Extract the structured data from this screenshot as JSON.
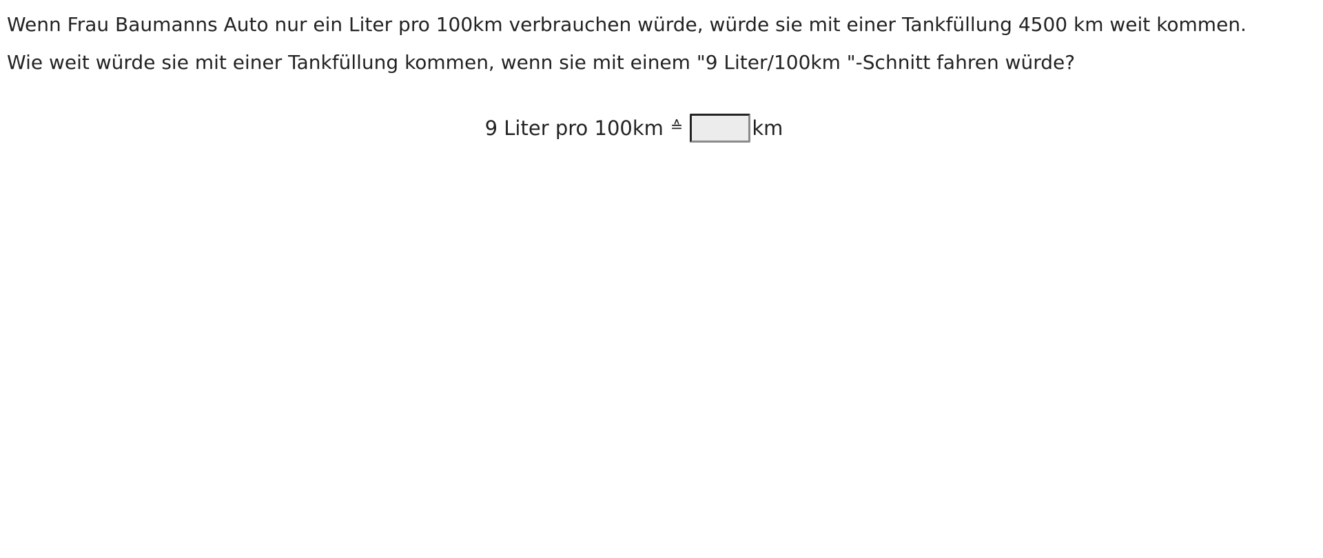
{
  "question": {
    "line1": "Wenn Frau Baumanns Auto nur ein Liter pro 100km verbrauchen würde, würde sie mit einer Tankfüllung 4500 km weit kommen.",
    "line2": "Wie weit würde sie mit einer Tankfüllung kommen, wenn sie mit einem \"9 Liter/100km \"-Schnitt fahren würde?"
  },
  "answer": {
    "prefix": "9 Liter pro 100km",
    "correspondence_symbol": "≙",
    "input_value": "",
    "input_placeholder": "",
    "unit": "km"
  },
  "colors": {
    "text": "#222222",
    "input_background": "#ececec",
    "input_border_dark": "#222222",
    "input_border_light": "#8a8a8a"
  }
}
